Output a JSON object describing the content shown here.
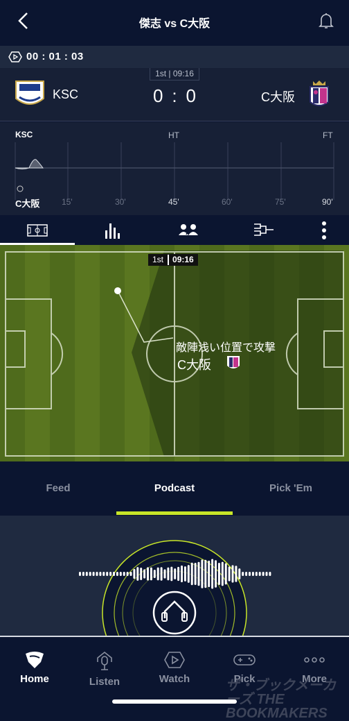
{
  "header": {
    "title": "傑志 vs C大阪",
    "back_icon": "chevron-left-icon",
    "bell_icon": "bell-icon"
  },
  "timer": {
    "value": "00 : 01 : 03",
    "icon": "play-hexagon-icon"
  },
  "match": {
    "period": "1st | 09:16",
    "home": "KSC",
    "away": "C大阪",
    "home_score": "0",
    "sep": ":",
    "away_score": "0"
  },
  "momentum": {
    "home_label": "KSC",
    "away_label": "C大阪",
    "ht": "HT",
    "ft": "FT",
    "ticks": [
      "15'",
      "30'",
      "45'",
      "60'",
      "75'",
      "90'"
    ]
  },
  "pitch": {
    "clock_period": "1st",
    "clock_time": "09:16",
    "event_text": "敵陣浅い位置で攻撃",
    "event_team": "C大阪"
  },
  "tabs": [
    {
      "label": "Feed"
    },
    {
      "label": "Podcast",
      "active": true
    },
    {
      "label": "Pick 'Em"
    }
  ],
  "nav": [
    {
      "label": "Home",
      "active": true
    },
    {
      "label": "Listen"
    },
    {
      "label": "Watch"
    },
    {
      "label": "Pick"
    },
    {
      "label": "More"
    }
  ],
  "watermark": "ザ・ブックメーカーズ THE BOOKMAKERS",
  "colors": {
    "accent": "#c8e628",
    "bg": "#0b1530",
    "panel": "#1f2a40",
    "pitch": "#5d7a22"
  }
}
